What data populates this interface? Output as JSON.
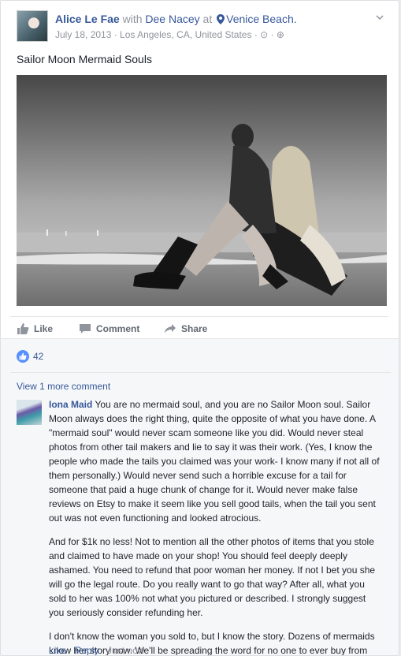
{
  "post": {
    "author": "Alice Le Fae",
    "with_word": "with",
    "tagged": "Dee Nacey",
    "at_word": "at",
    "place": "Venice Beach.",
    "date": "July 18, 2013 · Los Angeles, CA, United States · ⊙ · ⊕",
    "text": "Sailor Moon Mermaid Souls",
    "photo_icon": "beach-photo"
  },
  "actions": {
    "like": "Like",
    "comment": "Comment",
    "share": "Share"
  },
  "reactions": {
    "count": "42",
    "icon": "thumbs-up-icon"
  },
  "view_more": "View 1 more comment",
  "comment": {
    "author": "Iona Maid",
    "p1": "You are no mermaid soul, and you are no Sailor Moon soul. Sailor Moon always does the right thing, quite the opposite of what you have done. A \"mermaid soul\" would never scam someone like you did. Would never steal photos from other tail makers and lie to say it was their work. (Yes, I know the people who made the tails you claimed was your work- I know many if not all of them personally.) Would never send such a horrible excuse for a tail for someone that paid a huge chunk of change for it. Would never make false reviews on Etsy to make it seem like you sell good tails, when the tail you sent out was not even functioning and looked atrocious.",
    "p2": "And for $1k no less! Not to mention all the other photos of items that you stole and claimed to have made on your shop! You should feel deeply deeply ashamed. You need to refund that poor woman her money. If not I bet you she will go the legal route. Do you really want to go that way? After all, what you sold to her was 100% not what you pictured or described. I strongly suggest you seriously consider refunding her.",
    "p3": "I don't know the woman you sold to, but I know the story. Dozens of mermaids know her story now. We'll be spreading the word for no one to ever buy from your shop again. You mess with one of us, you mess with all of us!",
    "like": "Like",
    "sep": " · ",
    "reply": "Reply",
    "time": "Just now"
  }
}
